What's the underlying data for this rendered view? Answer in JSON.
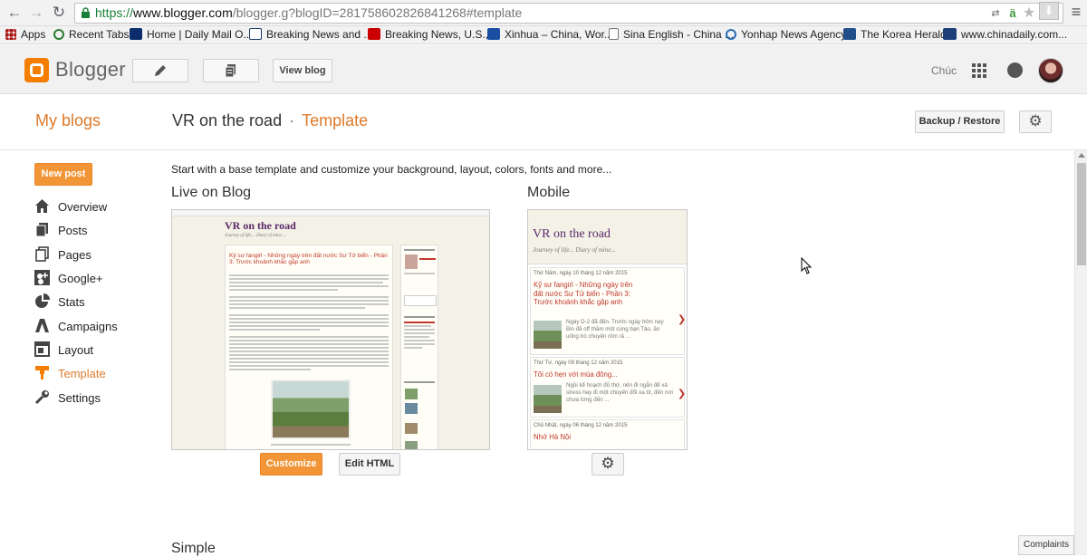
{
  "browser": {
    "url_scheme": "https://",
    "url_host": "www.blogger.com",
    "url_rest": "/blogger.g?blogID=2817586028268412​68#template",
    "bookmarks": [
      {
        "label": "Apps",
        "color": "#4285f4"
      },
      {
        "label": "Recent Tabs",
        "color": "#2e7d32"
      },
      {
        "label": "Home | Daily Mail O...",
        "color": "#0b2d6b"
      },
      {
        "label": "Breaking News and ...",
        "color": "#1b3a66"
      },
      {
        "label": "Breaking News, U.S.,...",
        "color": "#cc0000"
      },
      {
        "label": "Xinhua – China, Wor...",
        "color": "#1a4ea3"
      },
      {
        "label": "Sina English - China ...",
        "color": "#ffffff"
      },
      {
        "label": "Yonhap News Agency",
        "color": "#2a6fb5"
      },
      {
        "label": "The Korea Herald",
        "color": "#1f4e8a"
      },
      {
        "label": "www.chinadaily.com...",
        "color": "#1c3f7a"
      }
    ]
  },
  "header": {
    "logo_text": "Blogger",
    "view_blog_label": "View blog",
    "user_name": "Chúc",
    "brand_color": "#f57d00"
  },
  "title_row": {
    "my_blogs": "My blogs",
    "blog_name": "VR on the road",
    "separator": "·",
    "current_page": "Template",
    "backup_label": "Backup / Restore"
  },
  "sidebar": {
    "new_post_label": "New post",
    "items": [
      {
        "label": "Overview",
        "icon": "home-icon"
      },
      {
        "label": "Posts",
        "icon": "posts-icon"
      },
      {
        "label": "Pages",
        "icon": "pages-icon"
      },
      {
        "label": "Google+",
        "icon": "google-plus-icon"
      },
      {
        "label": "Stats",
        "icon": "stats-icon"
      },
      {
        "label": "Campaigns",
        "icon": "campaigns-icon"
      },
      {
        "label": "Layout",
        "icon": "layout-icon"
      },
      {
        "label": "Template",
        "icon": "template-icon",
        "active": true
      },
      {
        "label": "Settings",
        "icon": "settings-icon"
      }
    ]
  },
  "main": {
    "intro": "Start with a base template and customize your background, layout, colors, fonts and more...",
    "live_title": "Live on Blog",
    "mobile_title": "Mobile",
    "simple_title": "Simple",
    "customize_label": "Customize",
    "edit_html_label": "Edit HTML",
    "desktop_preview": {
      "blog_title": "VR on the road",
      "tagline": "Journey of life.... Diary of mine....",
      "post_title": "Kỹ sư fangirl - Những ngày trên đất nước Sư Tử biển - Phần 3: Trước khoảnh khắc gặp anh"
    },
    "mobile_preview": {
      "blog_title": "VR on the road",
      "tagline": "Journey of life... Diary of mine...",
      "posts": [
        {
          "date": "Thứ Năm, ngày 10 tháng 12 năm 2015",
          "title": "Kỹ sư fangirl - Những ngày trên đất nước Sư Tử biển - Phần 3: Trước khoảnh khắc gặp anh",
          "snippet": "Ngày D-2 đã đến. Trước ngày hôm nay Bin đã off thăm một cùng bạn Tảo, ăn uống trò chuyện rôm rả ..."
        },
        {
          "date": "Thứ Tư, ngày 09 tháng 12 năm 2015",
          "title": "Tôi có hẹn với mùa đông...",
          "snippet": "Ngồi kể hoạch đủ thứ, nên đi ngắn để xả stress hay đi một chuyến đổi xa tít, đến nơi chưa từng đến ..."
        },
        {
          "date": "Chủ Nhật, ngày 06 tháng 12 năm 2015",
          "title": "Nhớ Hà Nội",
          "snippet": ""
        }
      ]
    }
  },
  "footer": {
    "complaints_label": "Complaints"
  }
}
